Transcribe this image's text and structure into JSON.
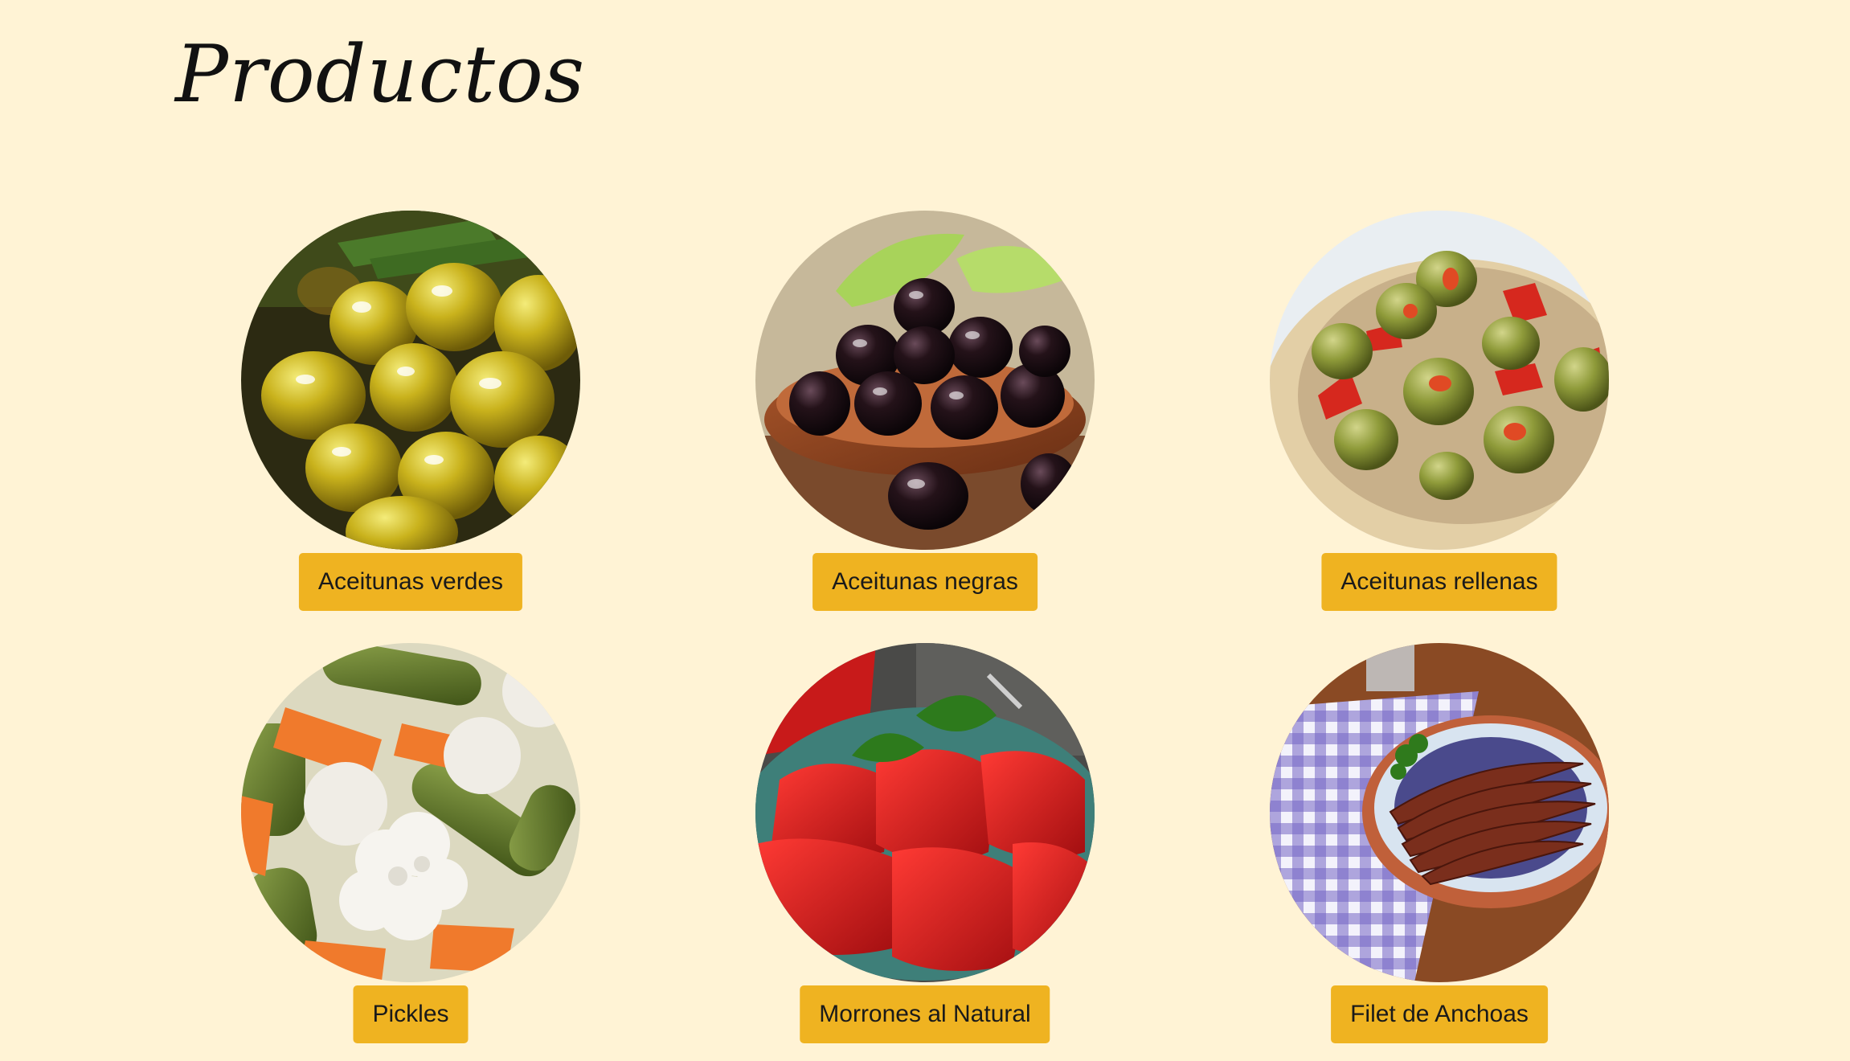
{
  "page": {
    "title": "Productos"
  },
  "products": [
    {
      "label": "Aceitunas verdes",
      "image": "green-olives-photo"
    },
    {
      "label": "Aceitunas negras",
      "image": "black-olives-photo"
    },
    {
      "label": "Aceitunas rellenas",
      "image": "stuffed-olives-photo"
    },
    {
      "label": "Pickles",
      "image": "pickles-photo"
    },
    {
      "label": "Morrones al Natural",
      "image": "red-peppers-photo"
    },
    {
      "label": "Filet de Anchoas",
      "image": "anchovies-photo"
    }
  ],
  "colors": {
    "background": "#fff3d5",
    "button": "#efb321",
    "text": "#1a1a1a"
  }
}
